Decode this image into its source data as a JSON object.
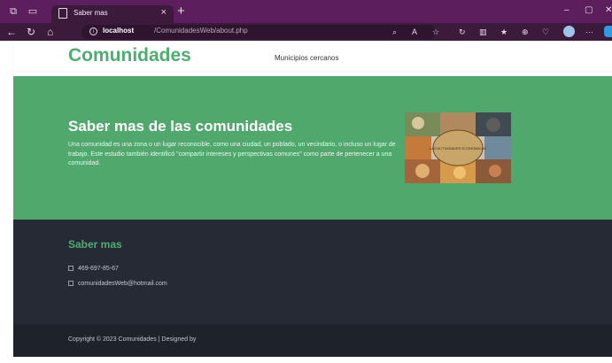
{
  "browser": {
    "tab_title": "Saber mas",
    "url_host": "localhost",
    "url_path": "/ComunidadesWeb/about.php",
    "tab_close": "×",
    "new_tab": "+"
  },
  "nav": {
    "brand": "Comunidades",
    "link": "Municipios cercanos"
  },
  "hero": {
    "title": "Saber mas de las comunidades",
    "text": "Una comunidad es una zona o un lugar reconocible, como una ciudad, un poblado, un vecindario, o incluso un lugar de trabajo. Este estudio también identificó \"compartir intereses y perspectivas comunes\" como parte de pertenecer a una comunidad.",
    "image_label": "LAS ACTIVIDADES ECONOMICAS"
  },
  "footer": {
    "title": "Saber mas",
    "phone": "469-697-85-67",
    "email": "comunidadesWeb@hotmail.com",
    "copyright": "Copyright © 2023 Comunidades | Designed by"
  },
  "colors": {
    "brand_green": "#4caf6f",
    "hero_bg": "#50a86d",
    "footer_bg": "#252a35",
    "browser_frame": "#5c1e5c"
  }
}
